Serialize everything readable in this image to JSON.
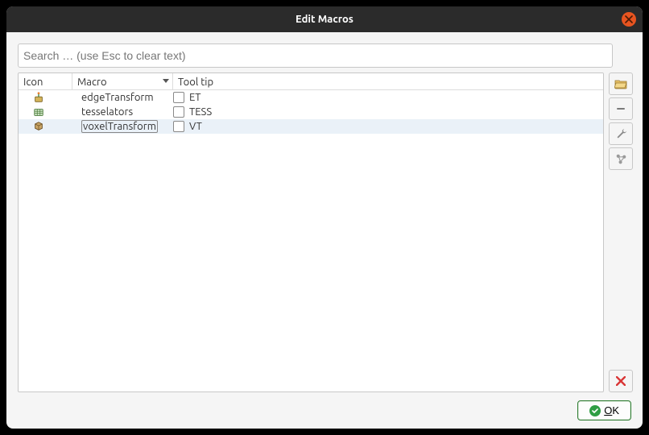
{
  "window": {
    "title": "Edit Macros"
  },
  "search": {
    "placeholder": "Search … (use Esc to clear text)",
    "value": ""
  },
  "columns": {
    "icon": "Icon",
    "macro": "Macro",
    "tooltip": "Tool tip"
  },
  "rows": [
    {
      "macro": "edgeTransform",
      "tooltip": "ET",
      "checked": false,
      "selected": false,
      "icon": "macro1"
    },
    {
      "macro": "tesselators",
      "tooltip": "TESS",
      "checked": false,
      "selected": false,
      "icon": "macro2"
    },
    {
      "macro": "voxelTransform",
      "tooltip": "VT",
      "checked": false,
      "selected": true,
      "icon": "macro3"
    }
  ],
  "buttons": {
    "ok": "OK"
  }
}
